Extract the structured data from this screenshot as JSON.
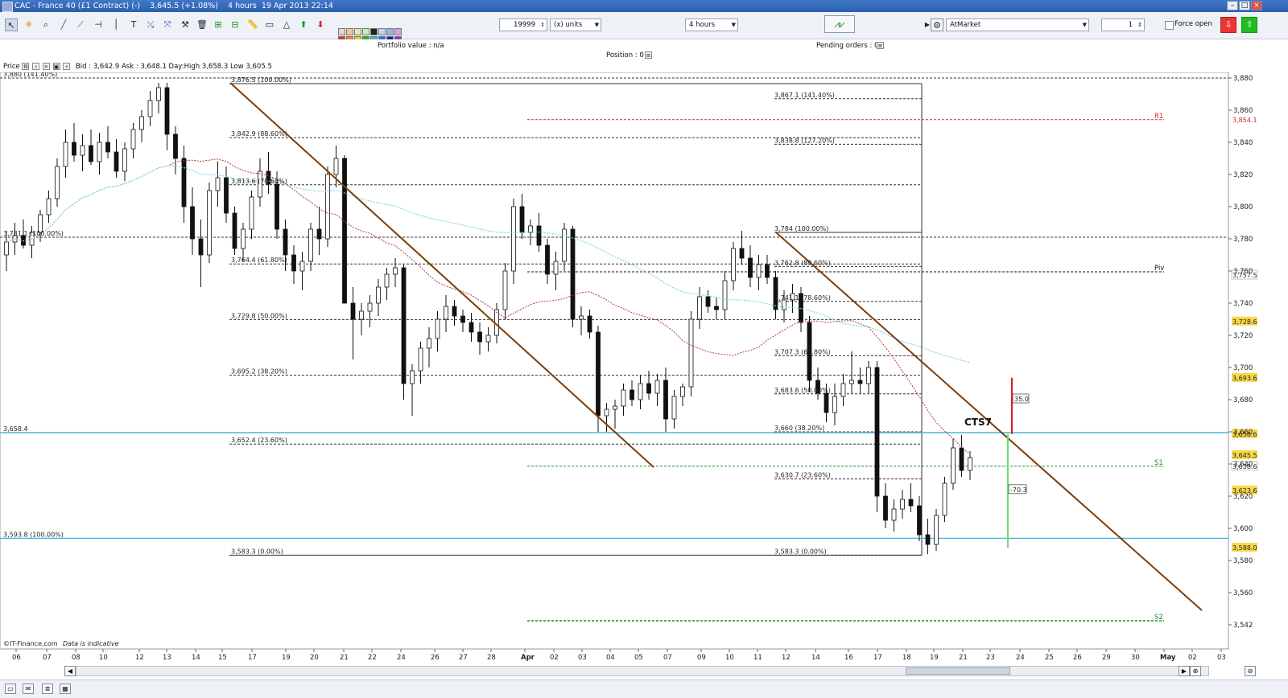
{
  "window": {
    "title": "CAC - France 40 (£1 Contract) (-)    3,645.5 (+1.08%)    4 hours  19 Apr 2013 22:14"
  },
  "toolbar": {
    "quantity": "19999",
    "units": "(x) units",
    "timeframe": "4 hours",
    "order_type": "AtMarket",
    "lots": "1",
    "force_open": "Force open"
  },
  "info": {
    "portfolio_value": "Portfolio value : n/a",
    "position": "Position : 0",
    "pending_orders": "Pending orders : 0"
  },
  "pricebar": {
    "label": "Price",
    "quote": "Bid : 3,642.9  Ask : 3,648.1  Day:High 3,658.3  Low 3,605.5"
  },
  "footer": {
    "source": "©IT-Finance.com",
    "note": "Data is indicative"
  },
  "colors": {
    "trendline": "#7a3e0c",
    "candle_up": "#ffffff",
    "candle_down": "#111111",
    "ma_red": "#b23a3a",
    "ma_cyan": "#7fd6e6",
    "horizontal_cyan": "#49b4dc",
    "marker_red": "#d42020",
    "marker_green": "#6fe06f",
    "current_price_bg": "#f9d84a",
    "r1": "#cc2a2a",
    "s_green": "#2a8a2a"
  },
  "chart_data": {
    "type": "candlestick",
    "ylim": [
      3530,
      3895
    ],
    "y_ticks": [
      3540,
      3560,
      3580,
      3600,
      3620,
      3640,
      3660,
      3680,
      3700,
      3720,
      3740,
      3760,
      3780,
      3800,
      3820,
      3840,
      3860,
      3880
    ],
    "y_tick_labels": [
      "3,542",
      "3,560",
      "3,580",
      "3,600",
      "3,620",
      "3,640",
      "3,660",
      "3,680",
      "3,700",
      "3,720",
      "3,740",
      "3,760",
      "3,780",
      "3,800",
      "3,820",
      "3,840",
      "3,860",
      "3,880"
    ],
    "x_ticks": [
      "06",
      "07",
      "08",
      "10",
      "12",
      "13",
      "14",
      "15",
      "17",
      "19",
      "20",
      "21",
      "22",
      "24",
      "26",
      "27",
      "28",
      "Apr",
      "02",
      "03",
      "04",
      "05",
      "07",
      "09",
      "10",
      "11",
      "12",
      "14",
      "16",
      "17",
      "18",
      "19",
      "21",
      "23",
      "24",
      "25",
      "26",
      "29",
      "30",
      "May",
      "02",
      "03"
    ],
    "price_labels": [
      {
        "text": "3,854.1",
        "price": 3854.1,
        "style": "r1"
      },
      {
        "text": "3,757.5",
        "price": 3757.5,
        "style": "plain"
      },
      {
        "text": "3,728.6",
        "price": 3728.6,
        "style": "yellow"
      },
      {
        "text": "3,693.6",
        "price": 3693.6,
        "style": "yellow"
      },
      {
        "text": "3,658.6",
        "price": 3658.6,
        "style": "yellow"
      },
      {
        "text": "3,645.5",
        "price": 3645.5,
        "style": "yellow"
      },
      {
        "text": "3,638.6",
        "price": 3638.6,
        "style": "plain"
      },
      {
        "text": "3,623.6",
        "price": 3623.6,
        "style": "yellow"
      },
      {
        "text": "3,588.0",
        "price": 3588.0,
        "style": "yellow"
      }
    ],
    "corner_labels": [
      {
        "text": "3,880 (141.40%)",
        "price": 3880
      },
      {
        "text": "3,781.1 (100.00%)",
        "price": 3781
      },
      {
        "text": "3,658.4",
        "price": 3659.5
      },
      {
        "text": "3,593.8 (100.00%)",
        "price": 3593.8
      }
    ],
    "fib_set_1": [
      {
        "text": "3,876.5 (100.00%)",
        "price": 3876.5
      },
      {
        "text": "3,842.9 (88.60%)",
        "price": 3842.9
      },
      {
        "text": "3,813.6 (78.60%)",
        "price": 3813.6
      },
      {
        "text": "3,764.4 (61.80%)",
        "price": 3764.4
      },
      {
        "text": "3,729.8 (50.00%)",
        "price": 3729.8
      },
      {
        "text": "3,695.2 (38.20%)",
        "price": 3695.2
      },
      {
        "text": "3,652.4 (23.60%)",
        "price": 3652.4
      },
      {
        "text": "3,583.3 (0.00%)",
        "price": 3583.3
      }
    ],
    "fib_set_2": [
      {
        "text": "3,867.1 (141.40%)",
        "price": 3867.1
      },
      {
        "text": "3,838.8 (127.20%)",
        "price": 3838.8
      },
      {
        "text": "3,784 (100.00%)",
        "price": 3784
      },
      {
        "text": "3,762.8 (88.60%)",
        "price": 3762.8
      },
      {
        "text": "3,741.1 (78.60%)",
        "price": 3741.1
      },
      {
        "text": "3,707.3 (61.80%)",
        "price": 3707.3
      },
      {
        "text": "3,683.6 (50.00%)",
        "price": 3683.6
      },
      {
        "text": "3,660 (38.20%)",
        "price": 3660
      },
      {
        "text": "3,630.7 (23.60%)",
        "price": 3630.7
      },
      {
        "text": "3,583.3 (0.00%)",
        "price": 3583.3
      }
    ],
    "pivots": [
      {
        "text": "R1",
        "price": 3854.1
      },
      {
        "text": "Piv",
        "price": 3759.5
      },
      {
        "text": "S1",
        "price": 3638.6
      },
      {
        "text": "S2",
        "price": 3542.5
      }
    ],
    "annotations": [
      {
        "text": "CTS7"
      },
      {
        "text": "35.0"
      },
      {
        "text": "-70.3"
      }
    ],
    "candles": [
      [
        3770,
        3785,
        3760,
        3778
      ],
      [
        3778,
        3790,
        3770,
        3782
      ],
      [
        3782,
        3792,
        3774,
        3776
      ],
      [
        3776,
        3788,
        3768,
        3784
      ],
      [
        3784,
        3798,
        3778,
        3795
      ],
      [
        3795,
        3810,
        3790,
        3805
      ],
      [
        3805,
        3830,
        3800,
        3825
      ],
      [
        3825,
        3848,
        3818,
        3840
      ],
      [
        3840,
        3852,
        3828,
        3832
      ],
      [
        3832,
        3845,
        3822,
        3838
      ],
      [
        3838,
        3848,
        3826,
        3828
      ],
      [
        3828,
        3846,
        3820,
        3840
      ],
      [
        3840,
        3850,
        3830,
        3834
      ],
      [
        3834,
        3842,
        3818,
        3822
      ],
      [
        3822,
        3840,
        3816,
        3836
      ],
      [
        3836,
        3852,
        3830,
        3848
      ],
      [
        3848,
        3860,
        3840,
        3856
      ],
      [
        3856,
        3872,
        3850,
        3866
      ],
      [
        3866,
        3877,
        3858,
        3874
      ],
      [
        3874,
        3877,
        3835,
        3845
      ],
      [
        3845,
        3850,
        3820,
        3830
      ],
      [
        3830,
        3838,
        3790,
        3800
      ],
      [
        3800,
        3812,
        3770,
        3780
      ],
      [
        3780,
        3792,
        3750,
        3770
      ],
      [
        3770,
        3815,
        3765,
        3810
      ],
      [
        3810,
        3828,
        3800,
        3818
      ],
      [
        3818,
        3825,
        3790,
        3796
      ],
      [
        3796,
        3800,
        3770,
        3774
      ],
      [
        3774,
        3790,
        3766,
        3786
      ],
      [
        3786,
        3810,
        3780,
        3806
      ],
      [
        3806,
        3830,
        3800,
        3822
      ],
      [
        3822,
        3834,
        3808,
        3814
      ],
      [
        3814,
        3822,
        3780,
        3786
      ],
      [
        3786,
        3792,
        3760,
        3770
      ],
      [
        3770,
        3776,
        3752,
        3760
      ],
      [
        3760,
        3772,
        3748,
        3766
      ],
      [
        3766,
        3790,
        3760,
        3786
      ],
      [
        3786,
        3800,
        3770,
        3780
      ],
      [
        3780,
        3825,
        3775,
        3820
      ],
      [
        3820,
        3838,
        3812,
        3830
      ],
      [
        3830,
        3832,
        3800,
        3740
      ],
      [
        3740,
        3750,
        3705,
        3730
      ],
      [
        3730,
        3740,
        3720,
        3735
      ],
      [
        3735,
        3745,
        3725,
        3740
      ],
      [
        3740,
        3755,
        3732,
        3750
      ],
      [
        3750,
        3762,
        3742,
        3758
      ],
      [
        3758,
        3768,
        3750,
        3762
      ],
      [
        3762,
        3764,
        3680,
        3690
      ],
      [
        3690,
        3702,
        3670,
        3698
      ],
      [
        3698,
        3716,
        3690,
        3712
      ],
      [
        3712,
        3725,
        3700,
        3718
      ],
      [
        3718,
        3735,
        3710,
        3730
      ],
      [
        3730,
        3745,
        3722,
        3738
      ],
      [
        3738,
        3742,
        3726,
        3732
      ],
      [
        3732,
        3736,
        3722,
        3728
      ],
      [
        3728,
        3734,
        3716,
        3722
      ],
      [
        3722,
        3728,
        3708,
        3716
      ],
      [
        3716,
        3725,
        3710,
        3720
      ],
      [
        3720,
        3740,
        3715,
        3736
      ],
      [
        3736,
        3765,
        3730,
        3760
      ],
      [
        3760,
        3805,
        3752,
        3800
      ],
      [
        3800,
        3808,
        3780,
        3784
      ],
      [
        3784,
        3792,
        3776,
        3788
      ],
      [
        3788,
        3796,
        3772,
        3776
      ],
      [
        3776,
        3780,
        3752,
        3758
      ],
      [
        3758,
        3772,
        3748,
        3766
      ],
      [
        3766,
        3790,
        3760,
        3786
      ],
      [
        3786,
        3788,
        3725,
        3730
      ],
      [
        3730,
        3738,
        3720,
        3732
      ],
      [
        3732,
        3736,
        3718,
        3722
      ],
      [
        3722,
        3726,
        3660,
        3670
      ],
      [
        3670,
        3678,
        3660,
        3674
      ],
      [
        3674,
        3680,
        3662,
        3676
      ],
      [
        3676,
        3690,
        3670,
        3686
      ],
      [
        3686,
        3692,
        3676,
        3680
      ],
      [
        3680,
        3695,
        3674,
        3690
      ],
      [
        3690,
        3698,
        3680,
        3684
      ],
      [
        3684,
        3696,
        3676,
        3692
      ],
      [
        3692,
        3700,
        3660,
        3668
      ],
      [
        3668,
        3686,
        3662,
        3682
      ],
      [
        3682,
        3690,
        3676,
        3688
      ],
      [
        3688,
        3735,
        3682,
        3730
      ],
      [
        3730,
        3750,
        3724,
        3744
      ],
      [
        3744,
        3748,
        3734,
        3738
      ],
      [
        3738,
        3744,
        3730,
        3736
      ],
      [
        3736,
        3760,
        3730,
        3754
      ],
      [
        3754,
        3778,
        3748,
        3774
      ],
      [
        3774,
        3785,
        3764,
        3768
      ],
      [
        3768,
        3776,
        3750,
        3756
      ],
      [
        3756,
        3770,
        3748,
        3764
      ],
      [
        3764,
        3770,
        3752,
        3756
      ],
      [
        3756,
        3760,
        3730,
        3736
      ],
      [
        3736,
        3748,
        3728,
        3742
      ],
      [
        3742,
        3752,
        3734,
        3746
      ],
      [
        3746,
        3750,
        3722,
        3728
      ],
      [
        3728,
        3732,
        3685,
        3692
      ],
      [
        3692,
        3700,
        3680,
        3684
      ],
      [
        3684,
        3690,
        3666,
        3672
      ],
      [
        3672,
        3690,
        3664,
        3682
      ],
      [
        3682,
        3696,
        3676,
        3690
      ],
      [
        3690,
        3710,
        3684,
        3692
      ],
      [
        3692,
        3700,
        3684,
        3690
      ],
      [
        3690,
        3704,
        3684,
        3700
      ],
      [
        3700,
        3704,
        3610,
        3620
      ],
      [
        3620,
        3628,
        3600,
        3605
      ],
      [
        3605,
        3618,
        3598,
        3612
      ],
      [
        3612,
        3624,
        3606,
        3618
      ],
      [
        3618,
        3628,
        3610,
        3614
      ],
      [
        3614,
        3620,
        3592,
        3596
      ],
      [
        3596,
        3606,
        3584,
        3590
      ],
      [
        3590,
        3612,
        3586,
        3608
      ],
      [
        3608,
        3632,
        3604,
        3628
      ],
      [
        3628,
        3656,
        3624,
        3650
      ],
      [
        3650,
        3658,
        3632,
        3636
      ],
      [
        3636,
        3648,
        3630,
        3644
      ]
    ]
  }
}
